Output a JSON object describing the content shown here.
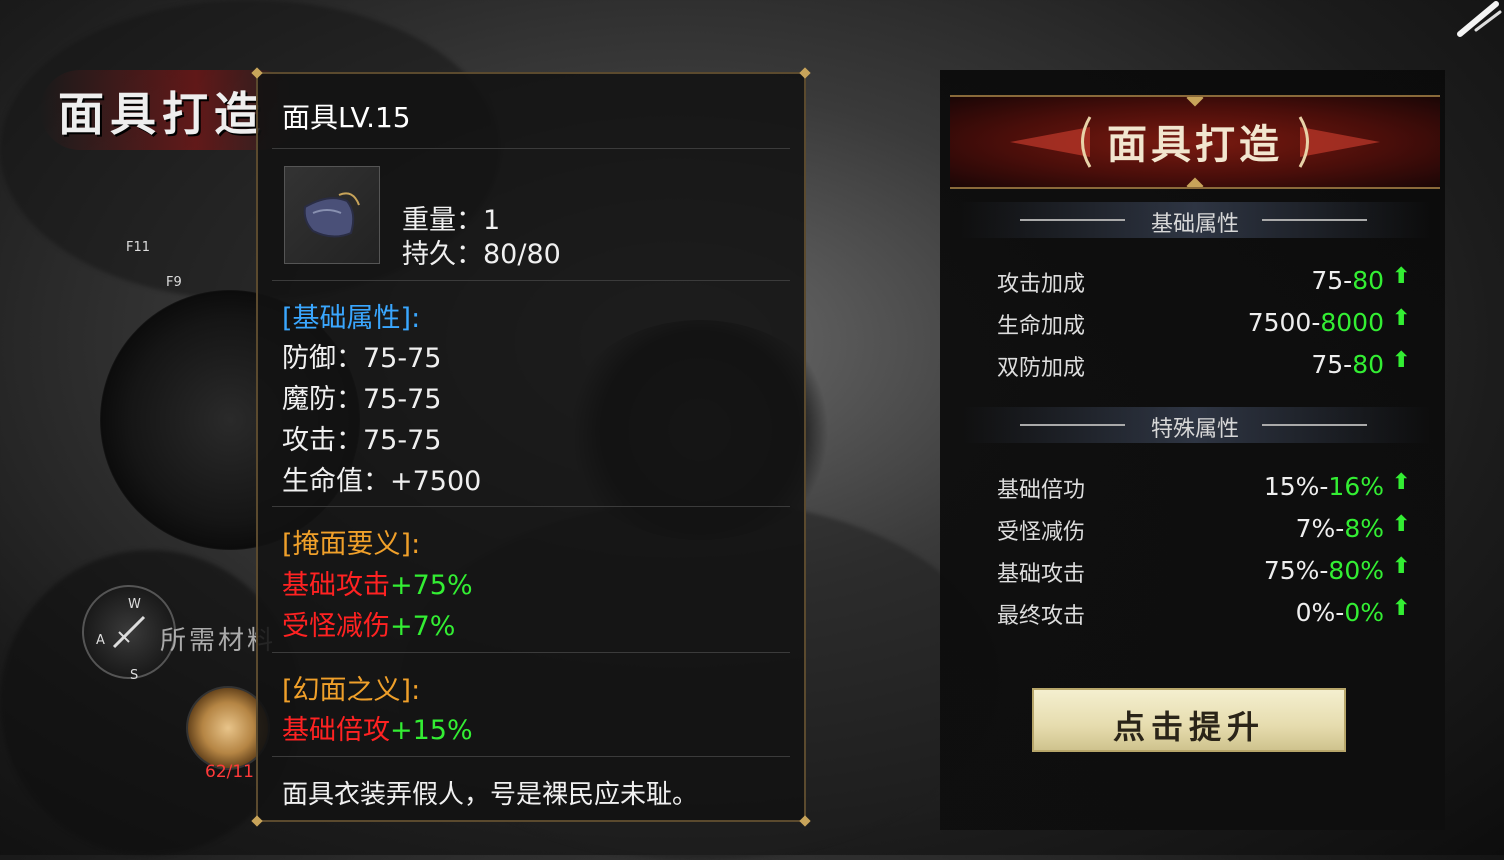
{
  "background": {
    "title": "面具打造",
    "floor_labels": [
      "F11",
      "F9"
    ],
    "compass": {
      "n": "W",
      "w": "A",
      "s": "S"
    },
    "required_materials_label": "所需材料",
    "material_count": "62/11"
  },
  "tooltip": {
    "name": "面具LV.15",
    "weight": "重量：1",
    "durability": "持久：80/80",
    "base_header": "[基础属性]:",
    "base_stats": [
      "防御：75-75",
      "魔防：75-75",
      "攻击：75-75",
      "生命值：+7500"
    ],
    "set1_header": "[掩面要义]:",
    "set1": [
      {
        "name": "基础攻击",
        "value": "+75%"
      },
      {
        "name": "受怪减伤",
        "value": "+7%"
      }
    ],
    "set2_header": "[幻面之义]:",
    "set2": [
      {
        "name": "基础倍攻",
        "value": "+15%"
      }
    ],
    "description": "面具衣装弄假人，号是裸民应未耻。"
  },
  "forge": {
    "title": "面具打造",
    "base_section": "基础属性",
    "base_attrs": [
      {
        "name": "攻击加成",
        "from": "75-",
        "to": "80"
      },
      {
        "name": "生命加成",
        "from": "7500-",
        "to": "8000"
      },
      {
        "name": "双防加成",
        "from": "75-",
        "to": "80"
      }
    ],
    "special_section": "特殊属性",
    "special_attrs": [
      {
        "name": "基础倍功",
        "from": "15%-",
        "to": "16%"
      },
      {
        "name": "受怪减伤",
        "from": "7%-",
        "to": "8%"
      },
      {
        "name": "基础攻击",
        "from": "75%-",
        "to": "80%"
      },
      {
        "name": "最终攻击",
        "from": "0%-",
        "to": "0%"
      }
    ],
    "upgrade_button": "点击提升",
    "arrow": "⬆"
  },
  "colors": {
    "green": "#33ee33",
    "red": "#ff2222",
    "blue": "#3aa7ff",
    "orange": "#f0a02a"
  }
}
